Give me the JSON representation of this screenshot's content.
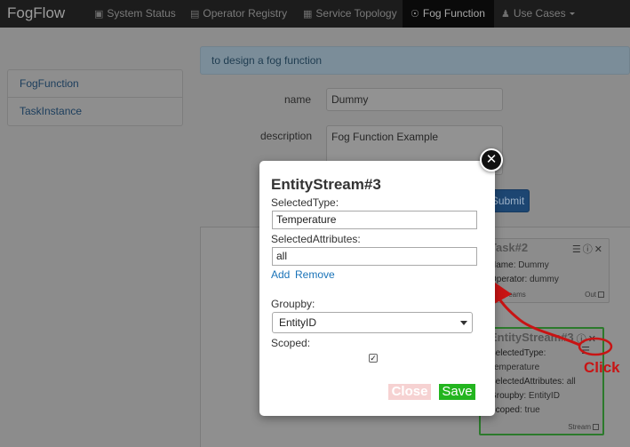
{
  "navbar": {
    "brand": "FogFlow",
    "items": [
      {
        "label": "System Status",
        "icon": "image-icon"
      },
      {
        "label": "Operator Registry",
        "icon": "list-icon"
      },
      {
        "label": "Service Topology",
        "icon": "grid-icon"
      },
      {
        "label": "Fog Function",
        "icon": "clock-icon",
        "active": true
      },
      {
        "label": "Use Cases",
        "icon": "user-icon",
        "dropdown": true
      }
    ]
  },
  "sidebar": {
    "items": [
      {
        "label": "FogFunction"
      },
      {
        "label": "TaskInstance"
      }
    ]
  },
  "form": {
    "banner": "to design a fog function",
    "name_label": "name",
    "name_value": "Dummy",
    "description_label": "description",
    "description_value": "Fog Function Example",
    "submit_label": "Submit"
  },
  "diagram": {
    "task_node": {
      "title": "Task#2",
      "name_key": "Name",
      "name_value": "Dummy",
      "operator_key": "Operator",
      "operator_value": "dummy",
      "in_port": "Streams",
      "out_port": "Out"
    },
    "stream_node": {
      "title": "EntityStream#3",
      "selected_type_key": "SelectedType",
      "selected_type_value": "Temperature",
      "selected_attributes_key": "SelectedAttributes",
      "selected_attributes_value": "all",
      "groupby_key": "Groupby",
      "groupby_value": "EntityID",
      "scoped_key": "Scoped",
      "scoped_value": "true",
      "out_port": "Stream"
    },
    "annotation_label": "Click",
    "annotation_color": "#c81414"
  },
  "modal": {
    "title": "EntityStream#3",
    "selected_type_label": "SelectedType:",
    "selected_type_value": "Temperature",
    "selected_attributes_label": "SelectedAttributes:",
    "selected_attributes_value": "all",
    "add_link": "Add",
    "remove_link": "Remove",
    "groupby_label": "Groupby:",
    "groupby_value": "EntityID",
    "scoped_label": "Scoped:",
    "scoped_checked": true,
    "close_label": "Close",
    "save_label": "Save",
    "save_color": "#23b51f"
  }
}
